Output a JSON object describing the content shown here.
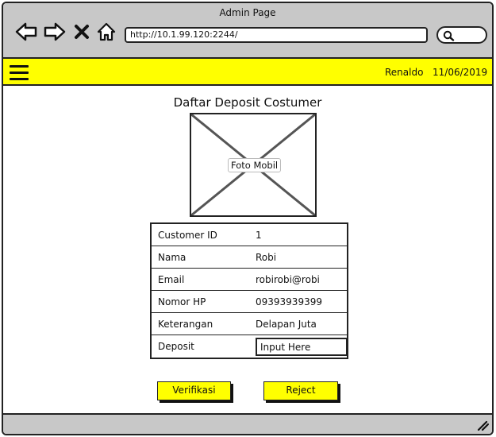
{
  "window": {
    "title": "Admin Page"
  },
  "toolbar": {
    "back_icon": "back-arrow-icon",
    "forward_icon": "forward-arrow-icon",
    "stop_icon": "close-x-icon",
    "home_icon": "home-icon",
    "url": "http://10.1.99.120:2244/",
    "search_icon": "search-icon"
  },
  "menubar": {
    "menu_icon": "hamburger-menu-icon",
    "user": "Renaldo",
    "date": "11/06/2019",
    "background": "#ffff00"
  },
  "main": {
    "title": "Daftar Deposit Costumer",
    "image_label": "Foto Mobil",
    "details": [
      {
        "label": "Customer ID",
        "value": "1"
      },
      {
        "label": "Nama",
        "value": "Robi"
      },
      {
        "label": "Email",
        "value": "robirobi@robi"
      },
      {
        "label": "Nomor HP",
        "value": "09393939399"
      },
      {
        "label": "Keterangan",
        "value": "Delapan Juta"
      }
    ],
    "deposit": {
      "label": "Deposit",
      "value": "Input Here"
    },
    "buttons": {
      "verify": "Verifikasi",
      "reject": "Reject"
    }
  },
  "colors": {
    "accent": "#ffff00",
    "chrome": "#c8c8c8",
    "border": "#222222"
  }
}
